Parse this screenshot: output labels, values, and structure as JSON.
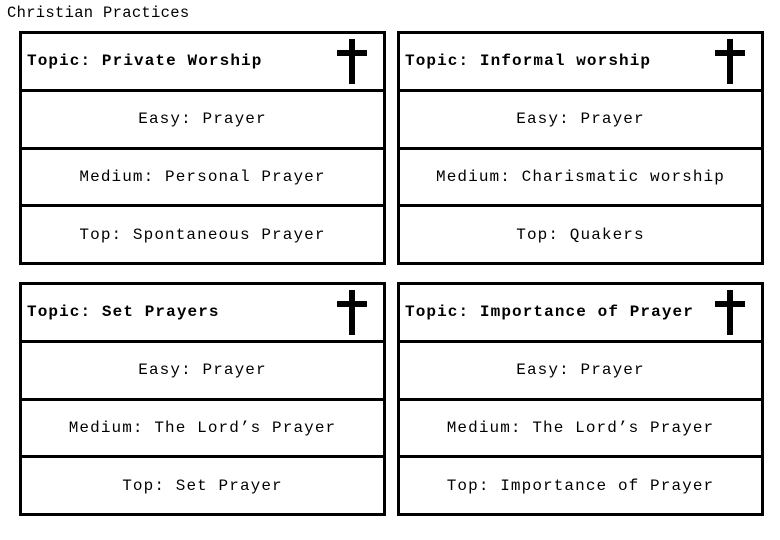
{
  "page": {
    "title": "Christian Practices"
  },
  "cards": [
    {
      "topic": "Topic: Private Worship",
      "icon": "cross-icon",
      "easy": "Easy: Prayer",
      "medium": "Medium: Personal Prayer",
      "top": "Top: Spontaneous Prayer"
    },
    {
      "topic": "Topic: Informal worship",
      "icon": "cross-icon",
      "easy": "Easy: Prayer",
      "medium": "Medium: Charismatic worship",
      "top": "Top: Quakers"
    },
    {
      "topic": "Topic: Set Prayers",
      "icon": "cross-icon",
      "easy": "Easy: Prayer",
      "medium": "Medium: The Lord’s Prayer",
      "top": "Top: Set Prayer"
    },
    {
      "topic": "Topic: Importance of Prayer",
      "icon": "cross-icon",
      "easy": "Easy: Prayer",
      "medium": "Medium: The Lord’s Prayer",
      "top": "Top: Importance of Prayer"
    }
  ]
}
